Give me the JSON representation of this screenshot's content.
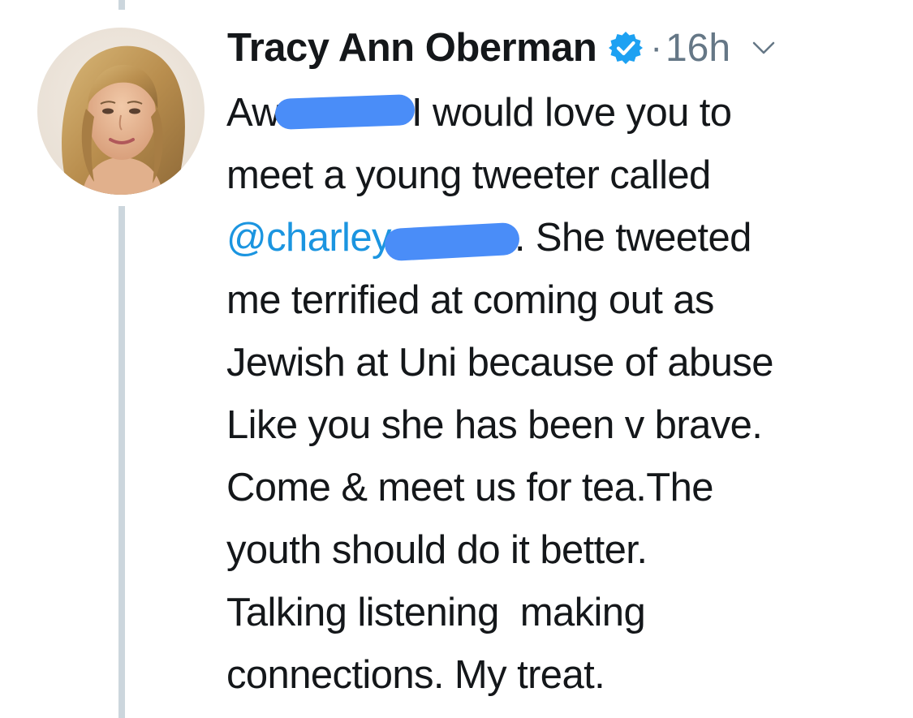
{
  "tweet": {
    "author_name": "Tracy Ann Oberman",
    "separator": "·",
    "timestamp": "16h",
    "line1": {
      "start": "Aw",
      "end": "I would love you to"
    },
    "line2": "meet a young tweeter called",
    "line3": {
      "mention": "@charley",
      "end": ". She tweeted"
    },
    "line4": "me terrified at coming out as",
    "line5": "Jewish at Uni because of abuse",
    "line6": "Like you she has been v brave.",
    "line7": "Come & meet us for tea.The",
    "line8": "youth should do it better.",
    "line9": "Talking listening  making",
    "line10": "connections. My treat."
  },
  "icons": {
    "verified": "verified-badge-icon",
    "menu": "chevron-down-icon"
  },
  "colors": {
    "text": "#14171a",
    "secondary": "#657786",
    "link": "#1b95e0",
    "verified": "#1da1f2",
    "thread_line": "#ccd6dd",
    "redaction": "#4a8df8"
  }
}
